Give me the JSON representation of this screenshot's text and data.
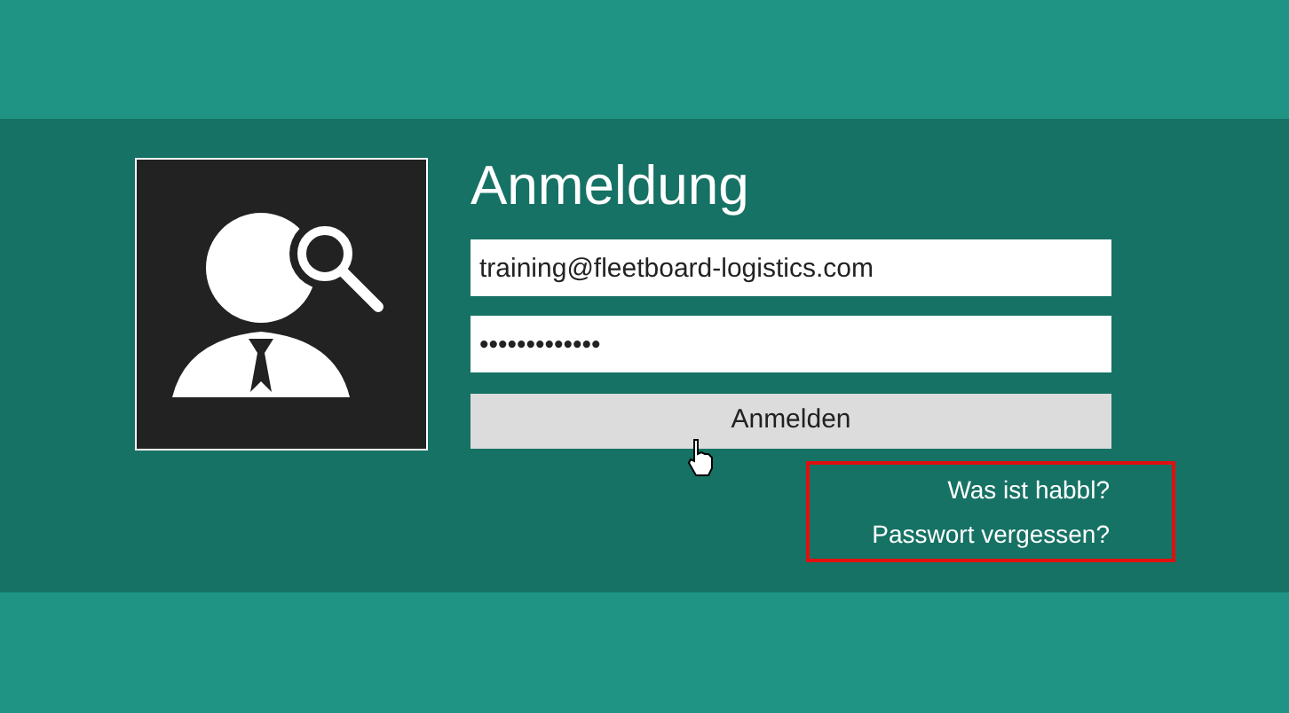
{
  "login": {
    "title": "Anmeldung",
    "email": {
      "value": "training@fleetboard-logistics.com"
    },
    "password": {
      "value": "•••••••••••••"
    },
    "submit": {
      "label": "Anmelden"
    },
    "links": [
      {
        "label": "Was ist habbl?"
      },
      {
        "label": "Passwort vergessen?"
      }
    ],
    "links_highlighted": true
  }
}
